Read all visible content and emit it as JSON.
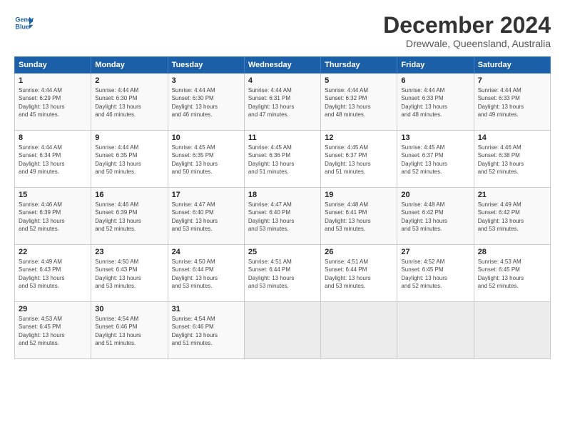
{
  "logo": {
    "line1": "General",
    "line2": "Blue"
  },
  "title": "December 2024",
  "subtitle": "Drewvale, Queensland, Australia",
  "days_of_week": [
    "Sunday",
    "Monday",
    "Tuesday",
    "Wednesday",
    "Thursday",
    "Friday",
    "Saturday"
  ],
  "weeks": [
    [
      {
        "day": "1",
        "info": "Sunrise: 4:44 AM\nSunset: 6:29 PM\nDaylight: 13 hours\nand 45 minutes."
      },
      {
        "day": "2",
        "info": "Sunrise: 4:44 AM\nSunset: 6:30 PM\nDaylight: 13 hours\nand 46 minutes."
      },
      {
        "day": "3",
        "info": "Sunrise: 4:44 AM\nSunset: 6:30 PM\nDaylight: 13 hours\nand 46 minutes."
      },
      {
        "day": "4",
        "info": "Sunrise: 4:44 AM\nSunset: 6:31 PM\nDaylight: 13 hours\nand 47 minutes."
      },
      {
        "day": "5",
        "info": "Sunrise: 4:44 AM\nSunset: 6:32 PM\nDaylight: 13 hours\nand 48 minutes."
      },
      {
        "day": "6",
        "info": "Sunrise: 4:44 AM\nSunset: 6:33 PM\nDaylight: 13 hours\nand 48 minutes."
      },
      {
        "day": "7",
        "info": "Sunrise: 4:44 AM\nSunset: 6:33 PM\nDaylight: 13 hours\nand 49 minutes."
      }
    ],
    [
      {
        "day": "8",
        "info": "Sunrise: 4:44 AM\nSunset: 6:34 PM\nDaylight: 13 hours\nand 49 minutes."
      },
      {
        "day": "9",
        "info": "Sunrise: 4:44 AM\nSunset: 6:35 PM\nDaylight: 13 hours\nand 50 minutes."
      },
      {
        "day": "10",
        "info": "Sunrise: 4:45 AM\nSunset: 6:35 PM\nDaylight: 13 hours\nand 50 minutes."
      },
      {
        "day": "11",
        "info": "Sunrise: 4:45 AM\nSunset: 6:36 PM\nDaylight: 13 hours\nand 51 minutes."
      },
      {
        "day": "12",
        "info": "Sunrise: 4:45 AM\nSunset: 6:37 PM\nDaylight: 13 hours\nand 51 minutes."
      },
      {
        "day": "13",
        "info": "Sunrise: 4:45 AM\nSunset: 6:37 PM\nDaylight: 13 hours\nand 52 minutes."
      },
      {
        "day": "14",
        "info": "Sunrise: 4:46 AM\nSunset: 6:38 PM\nDaylight: 13 hours\nand 52 minutes."
      }
    ],
    [
      {
        "day": "15",
        "info": "Sunrise: 4:46 AM\nSunset: 6:39 PM\nDaylight: 13 hours\nand 52 minutes."
      },
      {
        "day": "16",
        "info": "Sunrise: 4:46 AM\nSunset: 6:39 PM\nDaylight: 13 hours\nand 52 minutes."
      },
      {
        "day": "17",
        "info": "Sunrise: 4:47 AM\nSunset: 6:40 PM\nDaylight: 13 hours\nand 53 minutes."
      },
      {
        "day": "18",
        "info": "Sunrise: 4:47 AM\nSunset: 6:40 PM\nDaylight: 13 hours\nand 53 minutes."
      },
      {
        "day": "19",
        "info": "Sunrise: 4:48 AM\nSunset: 6:41 PM\nDaylight: 13 hours\nand 53 minutes."
      },
      {
        "day": "20",
        "info": "Sunrise: 4:48 AM\nSunset: 6:42 PM\nDaylight: 13 hours\nand 53 minutes."
      },
      {
        "day": "21",
        "info": "Sunrise: 4:49 AM\nSunset: 6:42 PM\nDaylight: 13 hours\nand 53 minutes."
      }
    ],
    [
      {
        "day": "22",
        "info": "Sunrise: 4:49 AM\nSunset: 6:43 PM\nDaylight: 13 hours\nand 53 minutes."
      },
      {
        "day": "23",
        "info": "Sunrise: 4:50 AM\nSunset: 6:43 PM\nDaylight: 13 hours\nand 53 minutes."
      },
      {
        "day": "24",
        "info": "Sunrise: 4:50 AM\nSunset: 6:44 PM\nDaylight: 13 hours\nand 53 minutes."
      },
      {
        "day": "25",
        "info": "Sunrise: 4:51 AM\nSunset: 6:44 PM\nDaylight: 13 hours\nand 53 minutes."
      },
      {
        "day": "26",
        "info": "Sunrise: 4:51 AM\nSunset: 6:44 PM\nDaylight: 13 hours\nand 53 minutes."
      },
      {
        "day": "27",
        "info": "Sunrise: 4:52 AM\nSunset: 6:45 PM\nDaylight: 13 hours\nand 52 minutes."
      },
      {
        "day": "28",
        "info": "Sunrise: 4:53 AM\nSunset: 6:45 PM\nDaylight: 13 hours\nand 52 minutes."
      }
    ],
    [
      {
        "day": "29",
        "info": "Sunrise: 4:53 AM\nSunset: 6:45 PM\nDaylight: 13 hours\nand 52 minutes."
      },
      {
        "day": "30",
        "info": "Sunrise: 4:54 AM\nSunset: 6:46 PM\nDaylight: 13 hours\nand 51 minutes."
      },
      {
        "day": "31",
        "info": "Sunrise: 4:54 AM\nSunset: 6:46 PM\nDaylight: 13 hours\nand 51 minutes."
      },
      {
        "day": "",
        "info": ""
      },
      {
        "day": "",
        "info": ""
      },
      {
        "day": "",
        "info": ""
      },
      {
        "day": "",
        "info": ""
      }
    ]
  ]
}
